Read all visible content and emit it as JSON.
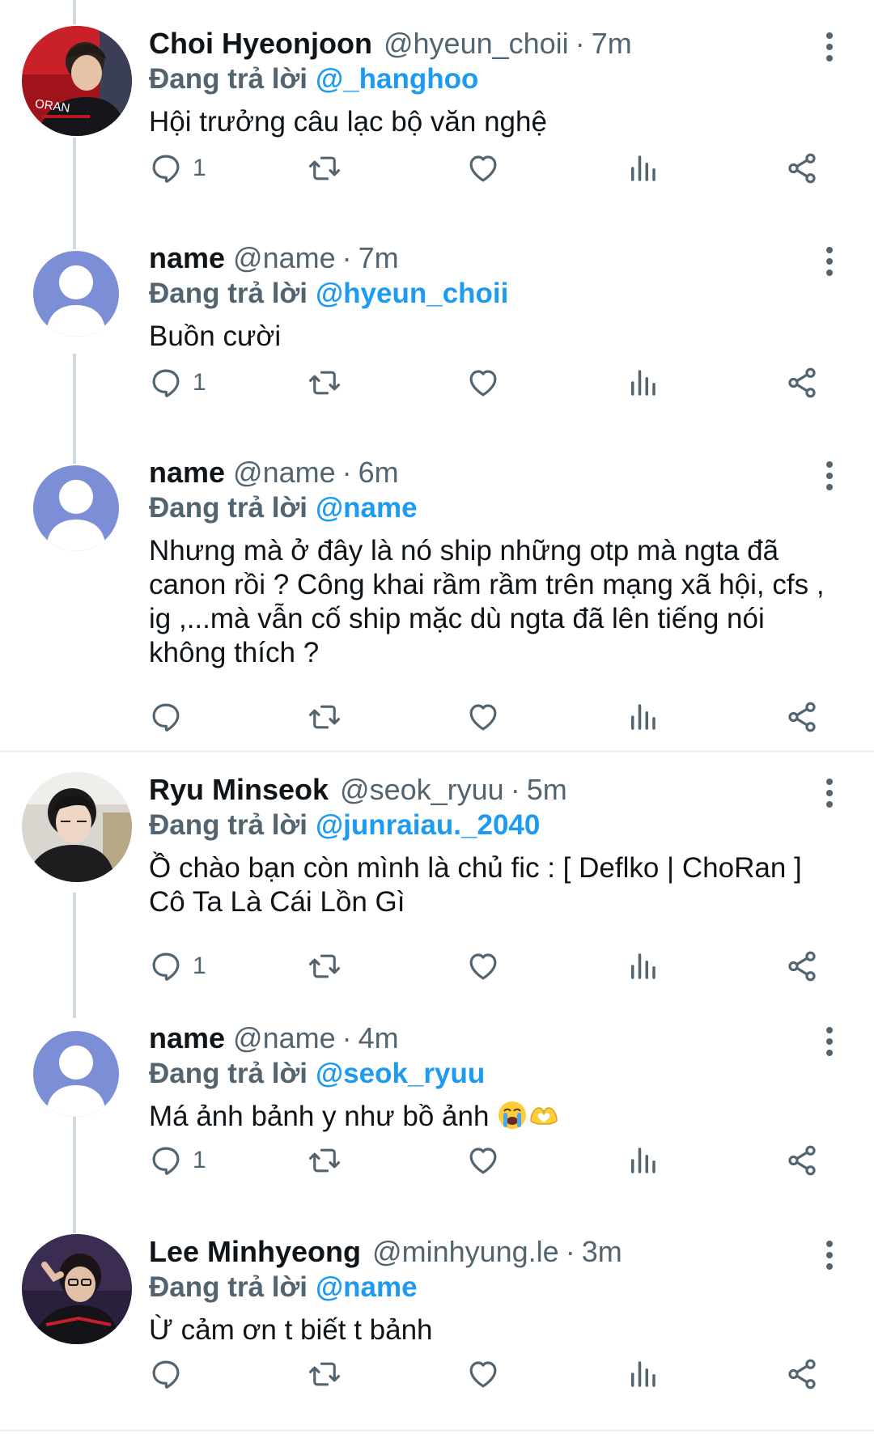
{
  "tweets": [
    {
      "name": "Choi Hyeonjoon",
      "handle": "@hyeun_choii",
      "time": "7m",
      "replying_label": "Đang trả lời",
      "mention": "@_hanghoo",
      "text": "Hội trưởng câu lạc bộ văn nghệ",
      "reply_count": "1",
      "avatar_label": "ORAN"
    },
    {
      "name": "name",
      "handle": "@name",
      "time": "7m",
      "replying_label": "Đang trả lời",
      "mention": "@hyeun_choii",
      "text": "Buồn cười",
      "reply_count": "1"
    },
    {
      "name": "name",
      "handle": "@name",
      "time": "6m",
      "replying_label": "Đang trả lời",
      "mention": "@name",
      "text": "Nhưng mà ở đây là nó ship những otp mà ngta đã canon rồi ? Công khai rầm rầm trên mạng xã hội, cfs , ig ,...mà vẫn cố ship mặc dù ngta đã lên tiếng nói không thích ?",
      "reply_count": ""
    },
    {
      "name": "Ryu Minseok",
      "handle": "@seok_ryuu",
      "time": "5m",
      "replying_label": "Đang trả lời",
      "mention": "@junraiau._2040",
      "text_line1": "Ồ chào bạn còn mình là chủ fic : [ Deflko | ChoRan ]",
      "text_line2": "Cô Ta Là Cái Lồn Gì",
      "reply_count": "1"
    },
    {
      "name": "name",
      "handle": "@name",
      "time": "4m",
      "replying_label": "Đang trả lời",
      "mention": "@seok_ryuu",
      "text": "Má ảnh bảnh y như bồ ảnh",
      "emoji": [
        "crying-face",
        "heart-hands"
      ],
      "reply_count": "1"
    },
    {
      "name": "Lee Minhyeong",
      "handle": "@minhyung.le",
      "time": "3m",
      "replying_label": "Đang trả lời",
      "mention": "@name",
      "text": "Ừ cảm ơn t biết t bảnh",
      "reply_count": ""
    }
  ],
  "separator": "·",
  "colors": {
    "link": "#1d9bf0",
    "secondary": "#536471",
    "thread_line": "#cfd9de",
    "default_avatar_bg": "#7c8fd6"
  },
  "icons": [
    "reply-icon",
    "retweet-icon",
    "like-icon",
    "views-icon",
    "share-icon",
    "more-icon"
  ]
}
